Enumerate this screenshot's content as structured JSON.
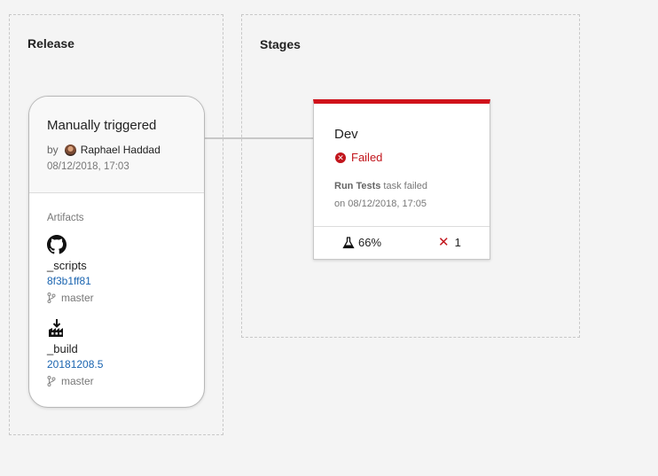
{
  "release_panel": {
    "title": "Release",
    "trigger": {
      "title": "Manually triggered",
      "by_prefix": "by",
      "author": "Raphael Haddad",
      "date": "08/12/2018, 17:03"
    },
    "artifacts_label": "Artifacts",
    "artifacts": [
      {
        "icon": "github-icon",
        "name": "_scripts",
        "version": "8f3b1ff81",
        "branch": "master"
      },
      {
        "icon": "build-icon",
        "name": "_build",
        "version": "20181208.5",
        "branch": "master"
      }
    ]
  },
  "stages_panel": {
    "title": "Stages",
    "stages": [
      {
        "name": "Dev",
        "status": "Failed",
        "status_color": "#c2151c",
        "task": "Run Tests",
        "task_suffix": "task failed",
        "time": "on 08/12/2018, 17:05",
        "test_pass_rate": "66%",
        "test_failed_count": "1"
      }
    ]
  },
  "colors": {
    "background": "#f4f4f4",
    "failed": "#c2151c",
    "failed_bar": "#d0121b",
    "link": "#1a64b0"
  }
}
